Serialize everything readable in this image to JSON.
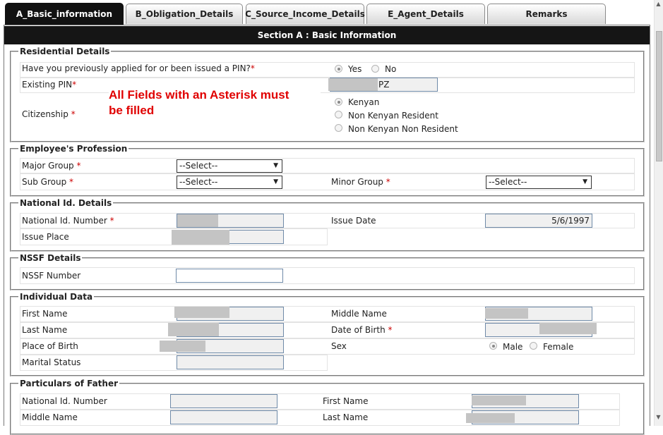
{
  "tabs": [
    {
      "label": "A_Basic_information",
      "active": true
    },
    {
      "label": "B_Obligation_Details",
      "active": false
    },
    {
      "label": "C_Source_Income_Details",
      "active": false
    },
    {
      "label": "E_Agent_Details",
      "active": false
    },
    {
      "label": "Remarks",
      "active": false
    }
  ],
  "section_title": "Section A : Basic Information",
  "note": "All Fields with an Asterisk must be filled",
  "note_lines": [
    "All Fields with an Asterisk must",
    "be filled"
  ],
  "asterisk": "*",
  "residential": {
    "legend": "Residential Details",
    "pin_question": "Have you previously applied for or been issued a PIN?",
    "yes": "Yes",
    "no": "No",
    "existing_pin_label": "Existing PIN",
    "existing_pin_value": "PZ",
    "citizenship_label": "Citizenship",
    "citizenship_options": [
      "Kenyan",
      "Non Kenyan Resident",
      "Non Kenyan Non Resident"
    ]
  },
  "profession": {
    "legend": "Employee's Profession",
    "major_group_label": "Major Group",
    "sub_group_label": "Sub Group",
    "minor_group_label": "Minor Group",
    "select_placeholder": "--Select--"
  },
  "national_id": {
    "legend": "National Id. Details",
    "number_label": "National Id. Number",
    "issue_date_label": "Issue Date",
    "issue_date_value": "5/6/1997",
    "issue_place_label": "Issue Place"
  },
  "nssf": {
    "legend": "NSSF Details",
    "number_label": "NSSF Number"
  },
  "individual": {
    "legend": "Individual Data",
    "first_name_label": "First Name",
    "middle_name_label": "Middle Name",
    "last_name_label": "Last Name",
    "dob_label": "Date of Birth",
    "place_of_birth_label": "Place of Birth",
    "sex_label": "Sex",
    "male": "Male",
    "female": "Female",
    "marital_status_label": "Marital Status"
  },
  "father": {
    "legend": "Particulars of Father",
    "national_id_label": "National Id. Number",
    "first_name_label": "First Name",
    "middle_name_label": "Middle Name",
    "last_name_label": "Last Name"
  },
  "colors": {
    "header_bg": "#151515",
    "required": "#cc0000",
    "note": "#e00000"
  }
}
